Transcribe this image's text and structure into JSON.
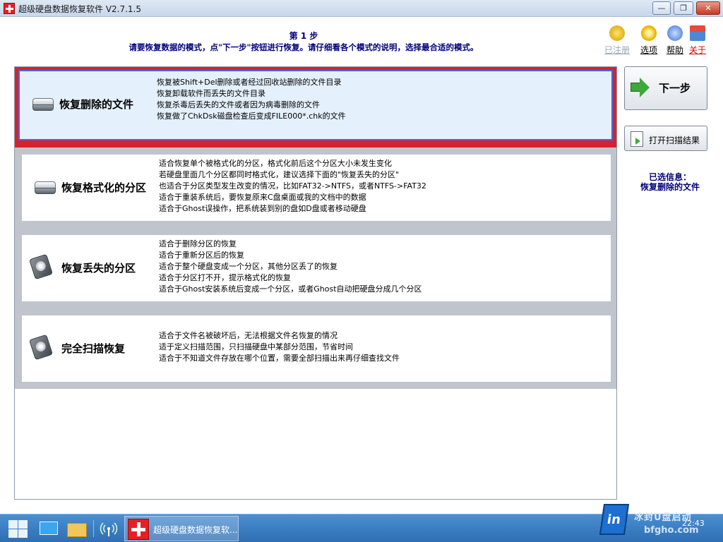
{
  "window": {
    "title": "超级硬盘数据恢复软件 V2.7.1.5",
    "buttons": {
      "minimize": "—",
      "maximize": "❐",
      "close": "✕"
    }
  },
  "header": {
    "step": "第 1 步",
    "description": "请要恢复数据的模式，点\"下一步\"按钮进行恢复。请仔细看各个模式的说明，选择最合适的模式。"
  },
  "toolbar": [
    {
      "label": "已注册",
      "icon": "cart-icon"
    },
    {
      "label": "选项",
      "icon": "gear-icon"
    },
    {
      "label": "帮助",
      "icon": "help-icon"
    },
    {
      "label": "关于",
      "icon": "house-icon"
    }
  ],
  "modes": [
    {
      "name": "恢复删除的文件",
      "icon": "disk-icon",
      "selected": true,
      "lines": [
        "恢复被Shift+Del删除或者经过回收站删除的文件目录",
        "恢复卸载软件而丢失的文件目录",
        "恢复杀毒后丢失的文件或者因为病毒删除的文件",
        "恢复做了ChkDsk磁盘检查后变成FILE000*.chk的文件"
      ]
    },
    {
      "name": "恢复格式化的分区",
      "icon": "disk-icon",
      "selected": false,
      "lines": [
        "适合恢复单个被格式化的分区，格式化前后这个分区大小未发生变化",
        "若硬盘里面几个分区都同时格式化，建议选择下面的\"恢复丢失的分区\"",
        "也适合于分区类型发生改变的情况，比如FAT32->NTFS，或者NTFS->FAT32",
        "适合于重装系统后，要恢复原来C盘桌面或我的文档中的数据",
        "适合于Ghost误操作，把系统装到别的盘如D盘或者移动硬盘"
      ]
    },
    {
      "name": "恢复丢失的分区",
      "icon": "hdd-icon",
      "selected": false,
      "lines": [
        "适合于删除分区的恢复",
        "适合于重新分区后的恢复",
        "适合于整个硬盘变成一个分区，其他分区丢了的恢复",
        "适合于分区打不开，提示格式化的恢复",
        "适合于Ghost安装系统后变成一个分区，或者Ghost自动把硬盘分成几个分区"
      ]
    },
    {
      "name": "完全扫描恢复",
      "icon": "hdd-icon",
      "selected": false,
      "lines": [
        "适合于文件名被破坏后，无法根据文件名恢复的情况",
        "适于定义扫描范围，只扫描硬盘中某部分范围，节省时间",
        "适合于不知道文件存放在哪个位置，需要全部扫描出来再仔细查找文件"
      ]
    }
  ],
  "actions": {
    "next_label": "下一步",
    "open_label": "打开扫描结果"
  },
  "selection": {
    "heading": "已选信息：",
    "value": "恢复删除的文件"
  },
  "taskbar": {
    "task_label": "超级硬盘数据恢复软...",
    "clock_time": "22:43",
    "watermark_1": "冰封U盘启动",
    "watermark_2": "bfgho.com"
  },
  "colors": {
    "selected_border": "#d5232c",
    "selected_inner": "#4a66d6",
    "header_text": "#00007a"
  }
}
